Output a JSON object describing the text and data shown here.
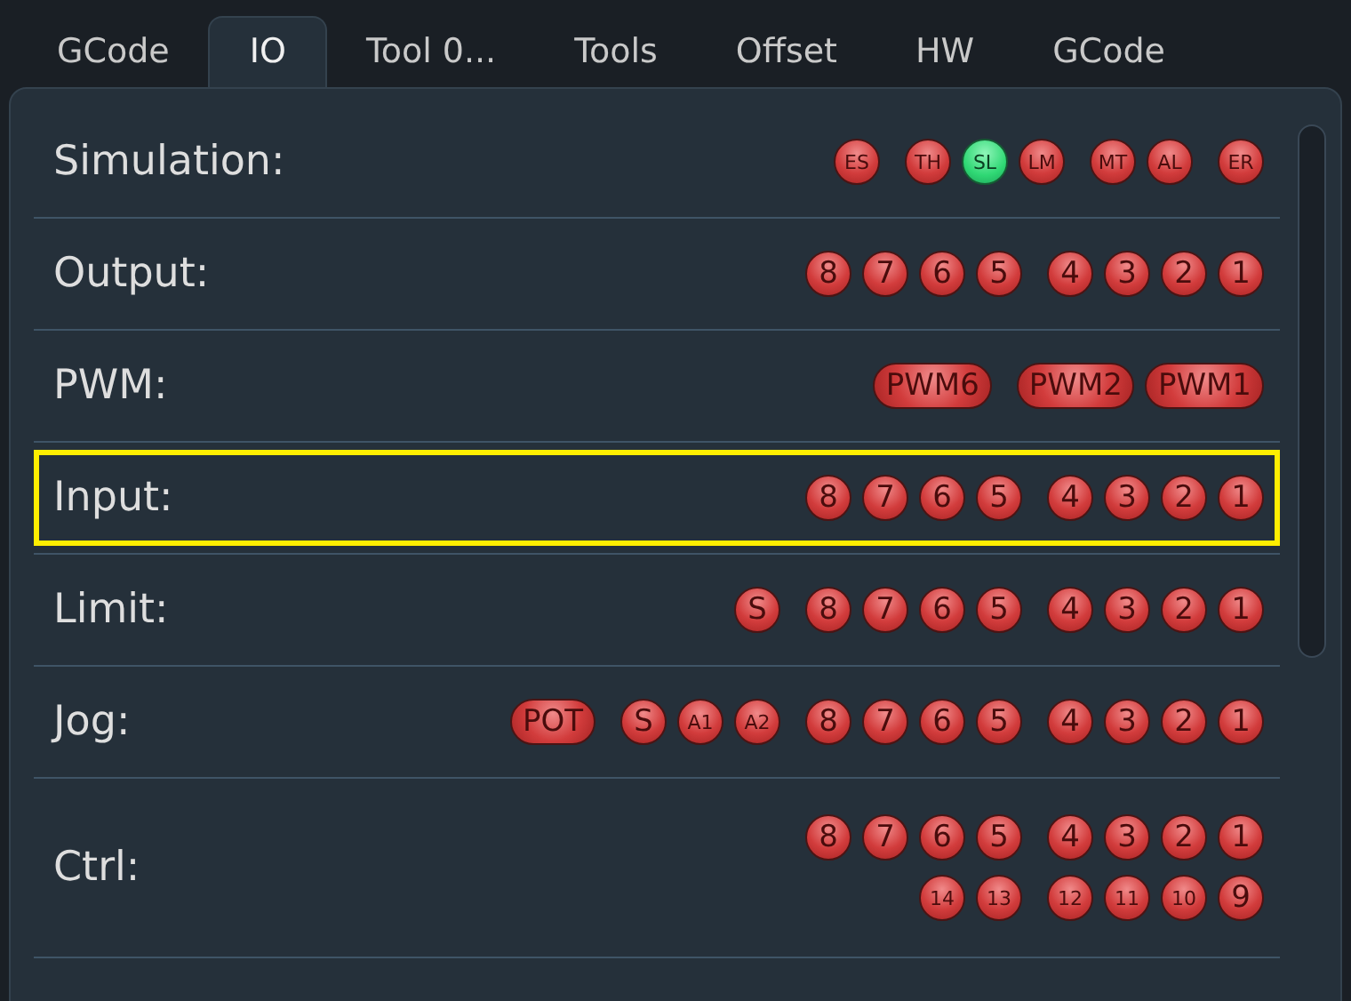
{
  "tabs": [
    {
      "label": "GCode",
      "selected": false
    },
    {
      "label": "IO",
      "selected": true
    },
    {
      "label": "Tool 0...",
      "selected": false
    },
    {
      "label": "Tools",
      "selected": false
    },
    {
      "label": "Offset",
      "selected": false
    },
    {
      "label": "HW",
      "selected": false
    },
    {
      "label": "GCode",
      "selected": false
    }
  ],
  "rows": [
    {
      "label": "Simulation:",
      "selected": false,
      "lines": [
        [
          [
            {
              "text": "ES",
              "kind": "round",
              "on": false
            }
          ],
          [
            {
              "text": "TH",
              "kind": "round",
              "on": false
            },
            {
              "text": "SL",
              "kind": "round",
              "on": true
            },
            {
              "text": "LM",
              "kind": "round",
              "on": false
            }
          ],
          [
            {
              "text": "MT",
              "kind": "round",
              "on": false
            },
            {
              "text": "AL",
              "kind": "round",
              "on": false
            }
          ],
          [
            {
              "text": "ER",
              "kind": "round",
              "on": false
            }
          ]
        ]
      ]
    },
    {
      "label": "Output:",
      "selected": false,
      "lines": [
        [
          [
            {
              "text": "8",
              "kind": "round",
              "on": false
            },
            {
              "text": "7",
              "kind": "round",
              "on": false
            },
            {
              "text": "6",
              "kind": "round",
              "on": false
            },
            {
              "text": "5",
              "kind": "round",
              "on": false
            }
          ],
          [
            {
              "text": "4",
              "kind": "round",
              "on": false
            },
            {
              "text": "3",
              "kind": "round",
              "on": false
            },
            {
              "text": "2",
              "kind": "round",
              "on": false
            },
            {
              "text": "1",
              "kind": "round",
              "on": false
            }
          ]
        ]
      ]
    },
    {
      "label": "PWM:",
      "selected": false,
      "lines": [
        [
          [
            {
              "text": "PWM6",
              "kind": "pill",
              "on": false
            }
          ],
          [
            {
              "text": "PWM2",
              "kind": "pill",
              "on": false
            },
            {
              "text": "PWM1",
              "kind": "pill",
              "on": false
            }
          ]
        ]
      ]
    },
    {
      "label": "Input:",
      "selected": true,
      "lines": [
        [
          [
            {
              "text": "8",
              "kind": "round",
              "on": false
            },
            {
              "text": "7",
              "kind": "round",
              "on": false
            },
            {
              "text": "6",
              "kind": "round",
              "on": false
            },
            {
              "text": "5",
              "kind": "round",
              "on": false
            }
          ],
          [
            {
              "text": "4",
              "kind": "round",
              "on": false
            },
            {
              "text": "3",
              "kind": "round",
              "on": false
            },
            {
              "text": "2",
              "kind": "round",
              "on": false
            },
            {
              "text": "1",
              "kind": "round",
              "on": false
            }
          ]
        ]
      ]
    },
    {
      "label": "Limit:",
      "selected": false,
      "lines": [
        [
          [
            {
              "text": "S",
              "kind": "round",
              "on": false
            }
          ],
          [
            {
              "text": "8",
              "kind": "round",
              "on": false
            },
            {
              "text": "7",
              "kind": "round",
              "on": false
            },
            {
              "text": "6",
              "kind": "round",
              "on": false
            },
            {
              "text": "5",
              "kind": "round",
              "on": false
            }
          ],
          [
            {
              "text": "4",
              "kind": "round",
              "on": false
            },
            {
              "text": "3",
              "kind": "round",
              "on": false
            },
            {
              "text": "2",
              "kind": "round",
              "on": false
            },
            {
              "text": "1",
              "kind": "round",
              "on": false
            }
          ]
        ]
      ]
    },
    {
      "label": "Jog:",
      "selected": false,
      "lines": [
        [
          [
            {
              "text": "POT",
              "kind": "pill",
              "on": false
            }
          ],
          [
            {
              "text": "S",
              "kind": "round",
              "on": false
            },
            {
              "text": "A1",
              "kind": "round",
              "on": false
            },
            {
              "text": "A2",
              "kind": "round",
              "on": false
            }
          ],
          [
            {
              "text": "8",
              "kind": "round",
              "on": false
            },
            {
              "text": "7",
              "kind": "round",
              "on": false
            },
            {
              "text": "6",
              "kind": "round",
              "on": false
            },
            {
              "text": "5",
              "kind": "round",
              "on": false
            }
          ],
          [
            {
              "text": "4",
              "kind": "round",
              "on": false
            },
            {
              "text": "3",
              "kind": "round",
              "on": false
            },
            {
              "text": "2",
              "kind": "round",
              "on": false
            },
            {
              "text": "1",
              "kind": "round",
              "on": false
            }
          ]
        ]
      ]
    },
    {
      "label": "Ctrl:",
      "selected": false,
      "lines": [
        [
          [
            {
              "text": "8",
              "kind": "round",
              "on": false
            },
            {
              "text": "7",
              "kind": "round",
              "on": false
            },
            {
              "text": "6",
              "kind": "round",
              "on": false
            },
            {
              "text": "5",
              "kind": "round",
              "on": false
            }
          ],
          [
            {
              "text": "4",
              "kind": "round",
              "on": false
            },
            {
              "text": "3",
              "kind": "round",
              "on": false
            },
            {
              "text": "2",
              "kind": "round",
              "on": false
            },
            {
              "text": "1",
              "kind": "round",
              "on": false
            }
          ]
        ],
        [
          [
            {
              "text": "14",
              "kind": "round",
              "on": false
            },
            {
              "text": "13",
              "kind": "round",
              "on": false
            }
          ],
          [
            {
              "text": "12",
              "kind": "round",
              "on": false
            },
            {
              "text": "11",
              "kind": "round",
              "on": false
            },
            {
              "text": "10",
              "kind": "round",
              "on": false
            },
            {
              "text": "9",
              "kind": "round",
              "on": false
            }
          ]
        ]
      ]
    }
  ]
}
